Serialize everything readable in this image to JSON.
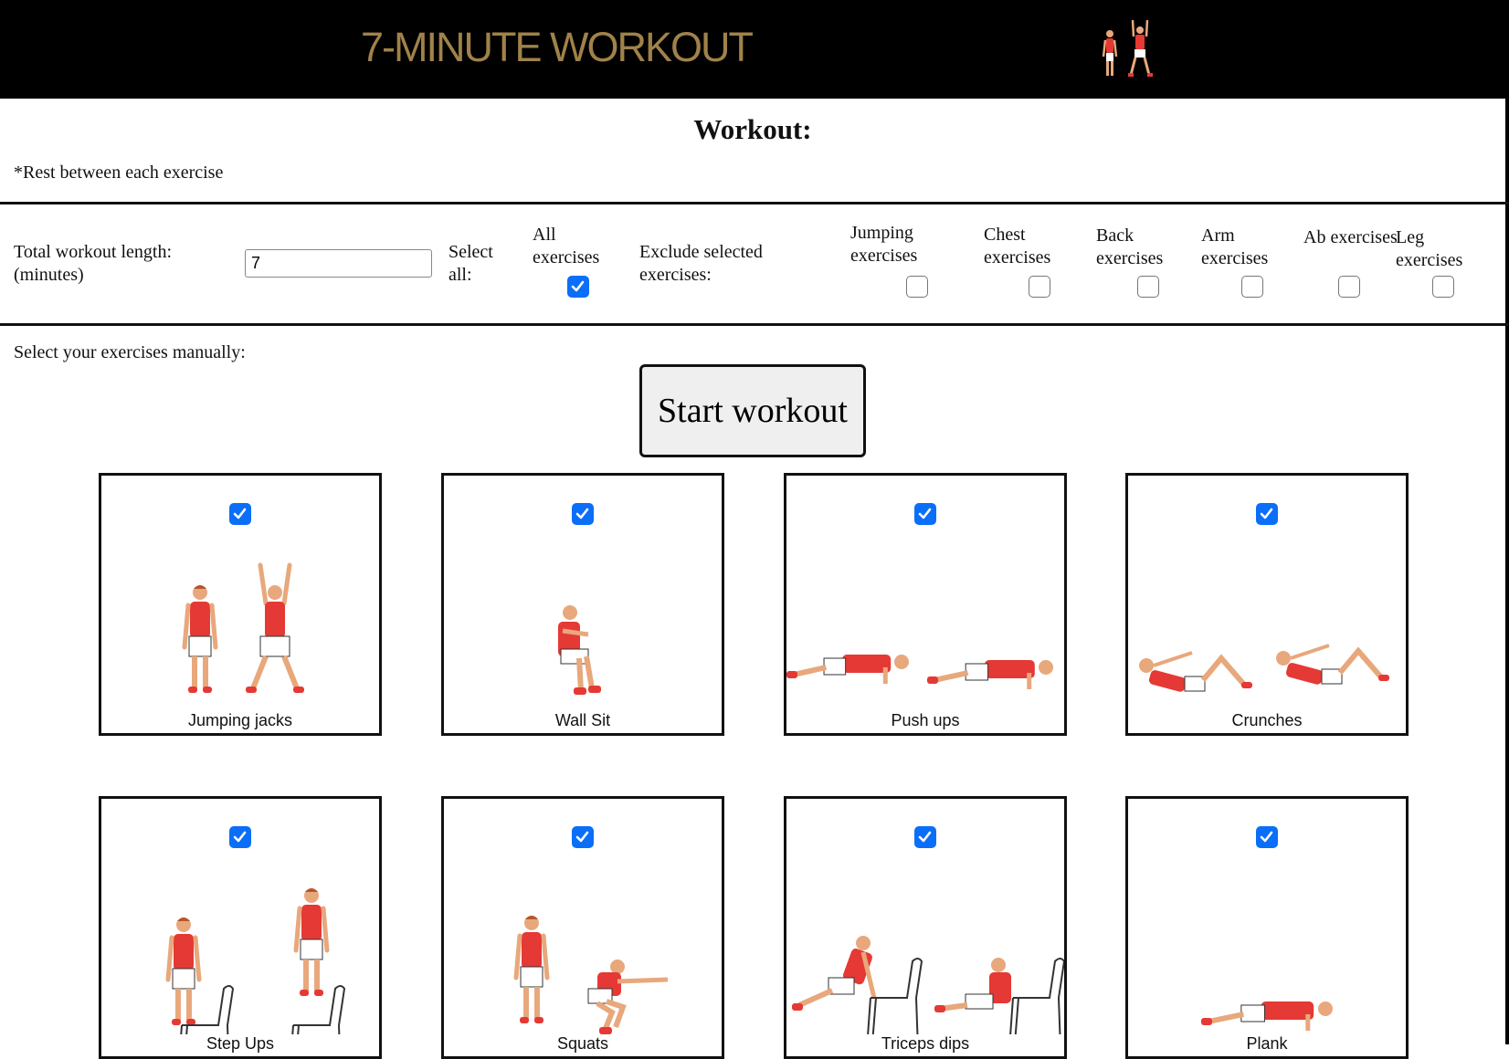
{
  "header": {
    "title": "7-MINUTE WORKOUT",
    "logo_icon": "jumping-figures-icon",
    "bg": "#000000",
    "title_color": "#a08249"
  },
  "workout": {
    "heading": "Workout:",
    "note": "*Rest between each exercise"
  },
  "settings": {
    "length_label": "Total workout length: (minutes)",
    "length_value": "7",
    "select_all_label": "Select all:",
    "all_exercises_label": "All exercises",
    "all_exercises_checked": true,
    "exclude_label": "Exclude selected exercises:",
    "categories": [
      {
        "label": "Jumping exercises",
        "checked": false
      },
      {
        "label": "Chest exercises",
        "checked": false
      },
      {
        "label": "Back exercises",
        "checked": false
      },
      {
        "label": "Arm exercises",
        "checked": false
      },
      {
        "label": "Ab exercises",
        "checked": false
      },
      {
        "label": "Leg exercises",
        "checked": false
      }
    ]
  },
  "manual": {
    "label": "Select your exercises manually:",
    "start_button": "Start workout"
  },
  "accent_color": "#0b6ef8",
  "exercises": [
    {
      "name": "Jumping jacks",
      "checked": true,
      "icon": "jumping-jacks-icon"
    },
    {
      "name": "Wall Sit",
      "checked": true,
      "icon": "wall-sit-icon"
    },
    {
      "name": "Push ups",
      "checked": true,
      "icon": "push-ups-icon"
    },
    {
      "name": "Crunches",
      "checked": true,
      "icon": "crunches-icon"
    },
    {
      "name": "Step Ups",
      "checked": true,
      "icon": "step-ups-icon"
    },
    {
      "name": "Squats",
      "checked": true,
      "icon": "squats-icon"
    },
    {
      "name": "Triceps dips",
      "checked": true,
      "icon": "triceps-dips-icon"
    },
    {
      "name": "Plank",
      "checked": true,
      "icon": "plank-icon"
    }
  ]
}
